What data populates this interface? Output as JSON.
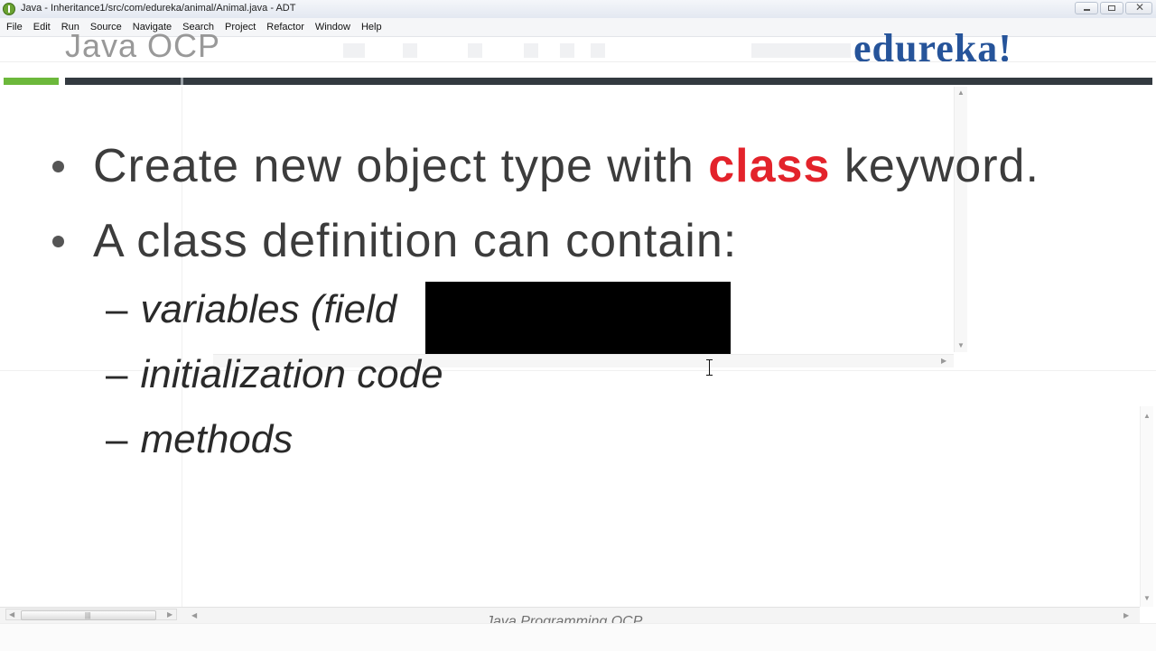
{
  "window": {
    "title": "Java - Inheritance1/src/com/edureka/animal/Animal.java - ADT",
    "close_glyph": "✕"
  },
  "menu": [
    "File",
    "Edit",
    "Run",
    "Source",
    "Navigate",
    "Search",
    "Project",
    "Refactor",
    "Window",
    "Help"
  ],
  "slide": {
    "header_title": "Java OCP",
    "brand": "edureka!",
    "bullets": [
      {
        "before": "Create new object type with ",
        "keyword": "class",
        "after": " keyword."
      },
      {
        "before": "A class definition can contain:",
        "keyword": "",
        "after": ""
      }
    ],
    "sub_dash": "–",
    "sub_items": [
      "variables (field",
      "initialization code",
      "methods"
    ],
    "footer": "Java Programming OCP"
  },
  "colors": {
    "keyword": "#e3232b",
    "brand": "#26549a",
    "accent_stripe": "#6cb83b"
  }
}
